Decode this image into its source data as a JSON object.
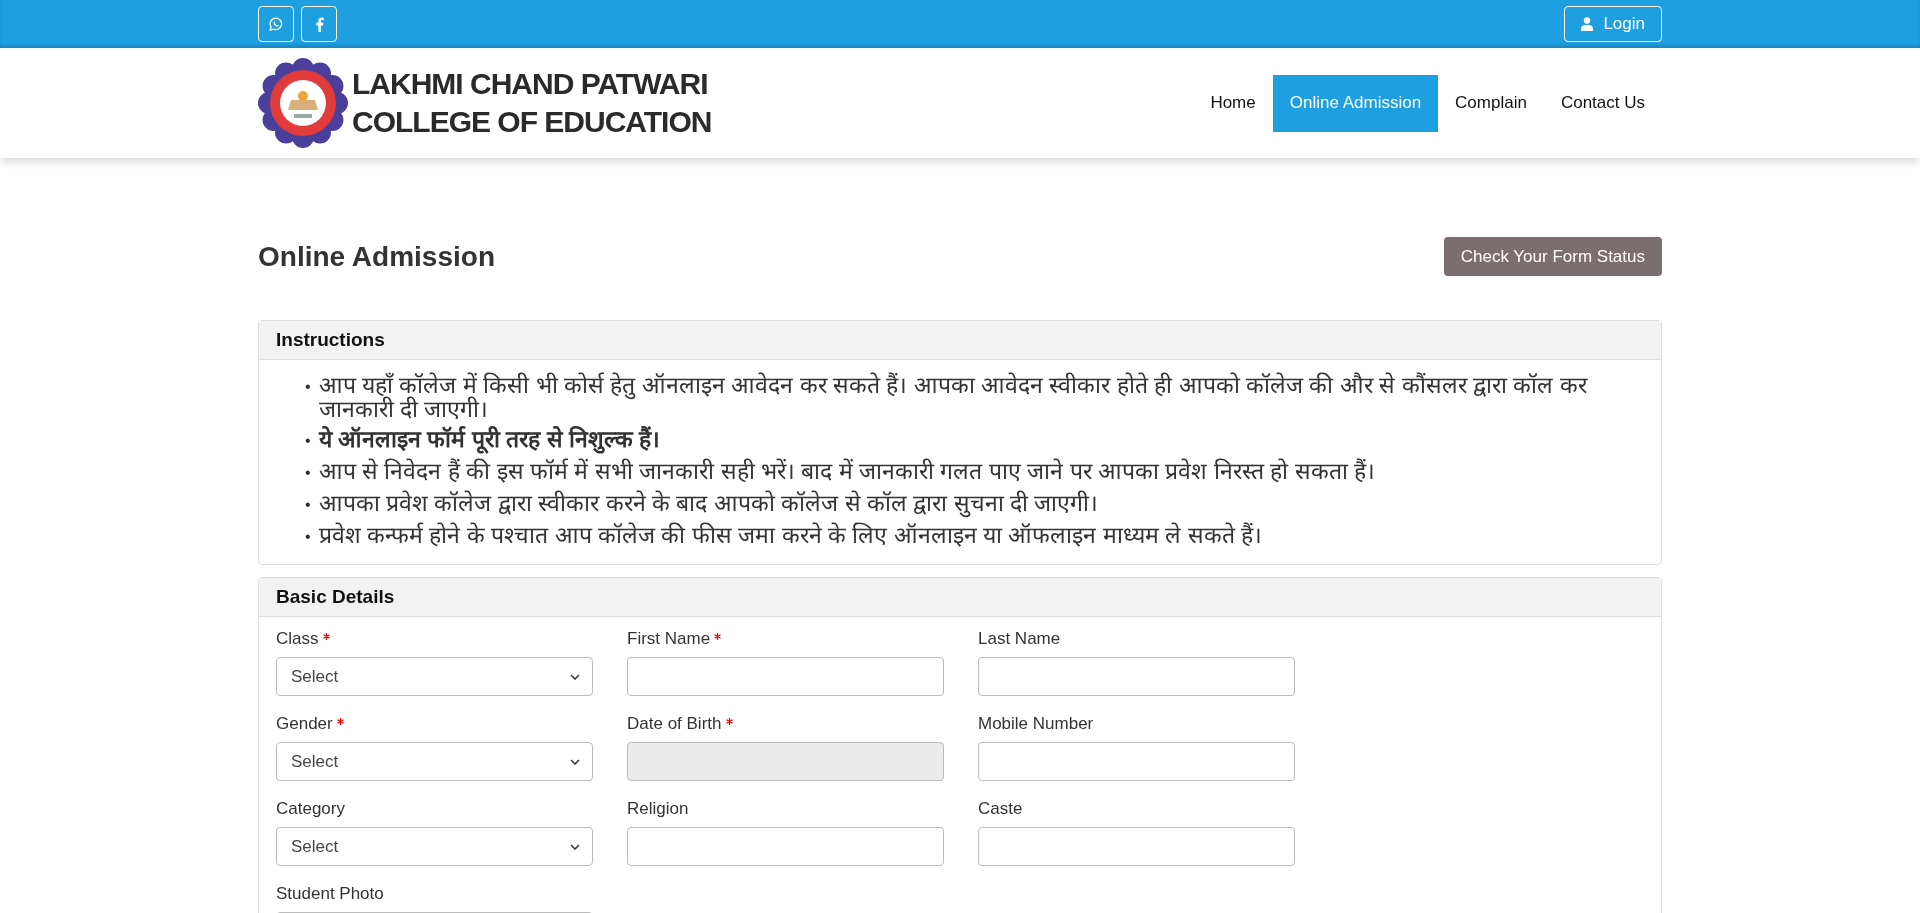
{
  "topbar": {
    "social": [
      {
        "kind": "whatsapp"
      },
      {
        "kind": "facebook"
      }
    ],
    "login": "Login"
  },
  "logo": {
    "lines": [
      "LAKHMI CHAND PATWARI",
      "COLLEGE OF EDUCATION"
    ]
  },
  "nav": [
    {
      "label": "Home",
      "selected": false
    },
    {
      "label": "Online Admission",
      "selected": true
    },
    {
      "label": "Complain",
      "selected": false
    },
    {
      "label": "Contact Us",
      "selected": false
    }
  ],
  "page": {
    "title": "Online Admission",
    "status_button": "Check Your Form Status"
  },
  "instructions": {
    "title": "Instructions",
    "bullet": "•",
    "items": [
      {
        "text": "आप यहाँ कॉलेज में किसी भी कोर्स हेतु ऑनलाइन आवेदन कर सकते हैं।  आपका आवेदन स्वीकार होते ही आपको कॉलेज की और से कौंसलर द्वारा कॉल कर जानकारी दी जाएगी।",
        "bold": false
      },
      {
        "text": "ये ऑनलाइन फॉर्म पूरी तरह से निशुल्क हैं।",
        "bold": true
      },
      {
        "text": "आप से निवेदन हैं की इस फॉर्म में सभी जानकारी सही भरें।  बाद में जानकारी गलत पाए जाने पर आपका प्रवेश निरस्त हो सकता हैं।",
        "bold": false
      },
      {
        "text": "आपका प्रवेश कॉलेज द्वारा स्वीकार करने के बाद आपको कॉलेज से कॉल द्वारा सुचना दी जाएगी।",
        "bold": false
      },
      {
        "text": "प्रवेश कन्फर्म होने के पश्चात आप कॉलेज की फीस जमा करने के लिए ऑनलाइन या ऑफलाइन माध्यम ले सकते हैं।",
        "bold": false
      }
    ]
  },
  "basic_details": {
    "title": "Basic Details",
    "fields": [
      {
        "label": "Class",
        "required": true,
        "kind": "select",
        "value": "Select"
      },
      {
        "label": "First Name",
        "required": true,
        "kind": "text"
      },
      {
        "label": "Last Name",
        "required": false,
        "kind": "text"
      },
      {
        "label": "Gender",
        "required": true,
        "kind": "select",
        "value": "Select"
      },
      {
        "label": "Date of Birth",
        "required": true,
        "kind": "text",
        "disabled": true
      },
      {
        "label": "Mobile Number",
        "required": false,
        "kind": "text"
      },
      {
        "label": "Category",
        "required": false,
        "kind": "select",
        "value": "Select"
      },
      {
        "label": "Religion",
        "required": false,
        "kind": "text"
      },
      {
        "label": "Caste",
        "required": false,
        "kind": "text"
      },
      {
        "label": "Student Photo",
        "required": false,
        "kind": "file"
      }
    ]
  }
}
